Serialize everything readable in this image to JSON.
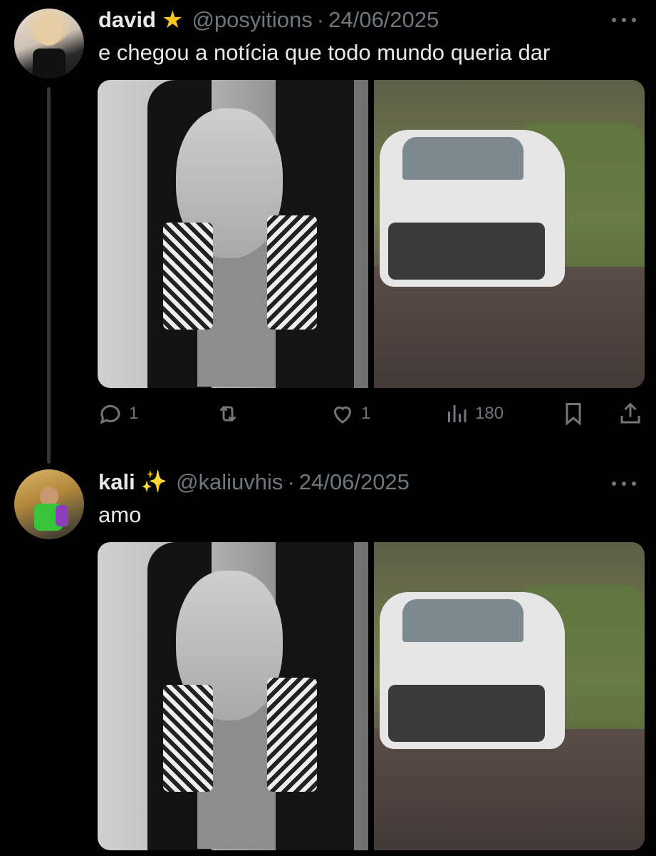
{
  "tweets": [
    {
      "author": {
        "name": "david",
        "badge": "★",
        "handle": "@posyitions",
        "separator": "·",
        "date": "24/06/2025"
      },
      "text": "e chegou a notícia que todo mundo queria dar",
      "media": [
        {
          "icon": "portrait-photo"
        },
        {
          "icon": "wrecked-car-photo"
        }
      ],
      "actions": {
        "reply_count": "1",
        "retweet_count": "",
        "like_count": "1",
        "views_count": "180"
      }
    },
    {
      "author": {
        "name": "kali",
        "badge": "✨",
        "handle": "@kaliuvhis",
        "separator": "·",
        "date": "24/06/2025"
      },
      "text": "amo",
      "media": [
        {
          "icon": "portrait-photo"
        },
        {
          "icon": "wrecked-car-photo"
        }
      ]
    }
  ],
  "colors": {
    "background": "#000000",
    "text_primary": "#e7e9ea",
    "text_secondary": "#71767b",
    "thread_line": "#333639",
    "star": "#f5c518"
  }
}
